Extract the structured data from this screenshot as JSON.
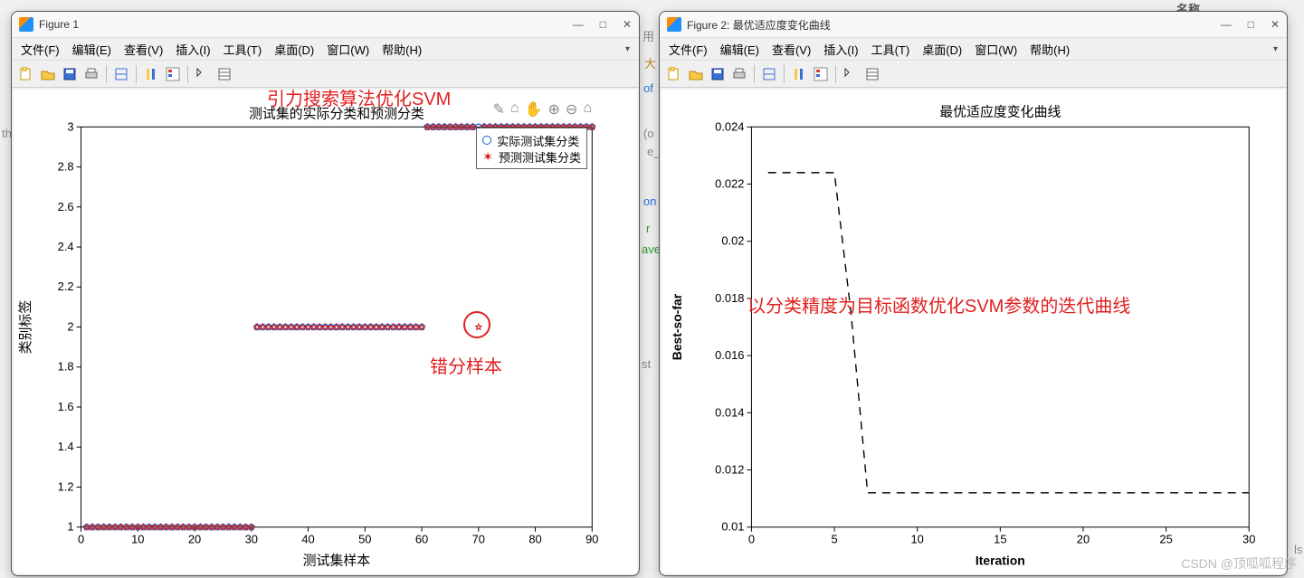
{
  "bg": {
    "text1": "用",
    "text2": "of",
    "text3": "e_",
    "text4": "on",
    "text5": "r",
    "text6": "ave",
    "text7": "st",
    "text8": "名称",
    "text9": "th",
    "text10": "ls",
    "text11": "(o",
    "text12": "大"
  },
  "watermark": "CSDN @顶呱呱程序",
  "fig1": {
    "title": "Figure 1",
    "menus": [
      "文件(F)",
      "编辑(E)",
      "查看(V)",
      "插入(I)",
      "工具(T)",
      "桌面(D)",
      "窗口(W)",
      "帮助(H)"
    ],
    "chart_title": "测试集的实际分类和预测分类",
    "xlabel": "测试集样本",
    "ylabel": "类别标签",
    "legend": {
      "actual": "实际测试集分类",
      "pred": "预测测试集分类"
    },
    "annot1": "引力搜索算法优化SVM",
    "annot2": "错分样本",
    "float_icons": [
      "✎",
      "⌂",
      "✋",
      "⊕",
      "⊖",
      "⌂"
    ]
  },
  "fig2": {
    "title": "Figure 2: 最优适应度变化曲线",
    "menus": [
      "文件(F)",
      "编辑(E)",
      "查看(V)",
      "插入(I)",
      "工具(T)",
      "桌面(D)",
      "窗口(W)",
      "帮助(H)"
    ],
    "chart_title": "最优适应度变化曲线",
    "xlabel": "Iteration",
    "ylabel": "Best-so-far",
    "annot1": "以分类精度为目标函数优化SVM参数的迭代曲线"
  },
  "winbtns": {
    "min": "—",
    "max": "□",
    "close": "✕"
  },
  "chart_data": [
    {
      "type": "scatter",
      "title": "测试集的实际分类和预测分类",
      "xlabel": "测试集样本",
      "ylabel": "类别标签",
      "xlim": [
        0,
        90
      ],
      "ylim": [
        1,
        3
      ],
      "xticks": [
        0,
        10,
        20,
        30,
        40,
        50,
        60,
        70,
        80,
        90
      ],
      "yticks": [
        1,
        1.2,
        1.4,
        1.6,
        1.8,
        2,
        2.2,
        2.4,
        2.6,
        2.8,
        3
      ],
      "series": [
        {
          "name": "实际测试集分类",
          "marker": "circle",
          "color": "#1060d0",
          "segments": [
            {
              "x_start": 1,
              "x_end": 30,
              "y": 1
            },
            {
              "x_start": 31,
              "x_end": 60,
              "y": 2
            },
            {
              "x_start": 61,
              "x_end": 90,
              "y": 3
            }
          ],
          "note": "integer x from 1..90; y is class label per segment"
        },
        {
          "name": "预测测试集分类",
          "marker": "star",
          "color": "#d01010",
          "segments": [
            {
              "x_start": 1,
              "x_end": 30,
              "y": 1
            },
            {
              "x_start": 31,
              "x_end": 60,
              "y": 2
            },
            {
              "x_start": 61,
              "x_end": 90,
              "y": 3
            }
          ],
          "outliers": [
            {
              "x": 70,
              "y": 2
            }
          ],
          "note": "matches actual except sample 70 predicted as class 2 instead of 3"
        }
      ],
      "legend_position": "upper-right-inset"
    },
    {
      "type": "line",
      "title": "最优适应度变化曲线",
      "xlabel": "Iteration",
      "ylabel": "Best-so-far",
      "xlim": [
        0,
        30
      ],
      "ylim": [
        0.01,
        0.024
      ],
      "xticks": [
        0,
        5,
        10,
        15,
        20,
        25,
        30
      ],
      "yticks": [
        0.01,
        0.012,
        0.014,
        0.016,
        0.018,
        0.02,
        0.022,
        0.024
      ],
      "style": "dashed",
      "color": "#000000",
      "x": [
        1,
        2,
        3,
        4,
        5,
        6,
        7,
        8,
        9,
        10,
        11,
        12,
        13,
        14,
        15,
        16,
        17,
        18,
        19,
        20,
        21,
        22,
        23,
        24,
        25,
        26,
        27,
        28,
        29,
        30
      ],
      "y": [
        0.0224,
        0.0224,
        0.0224,
        0.0224,
        0.0224,
        0.0175,
        0.0112,
        0.0112,
        0.0112,
        0.0112,
        0.0112,
        0.0112,
        0.0112,
        0.0112,
        0.0112,
        0.0112,
        0.0112,
        0.0112,
        0.0112,
        0.0112,
        0.0112,
        0.0112,
        0.0112,
        0.0112,
        0.0112,
        0.0112,
        0.0112,
        0.0112,
        0.0112,
        0.0112
      ]
    }
  ]
}
